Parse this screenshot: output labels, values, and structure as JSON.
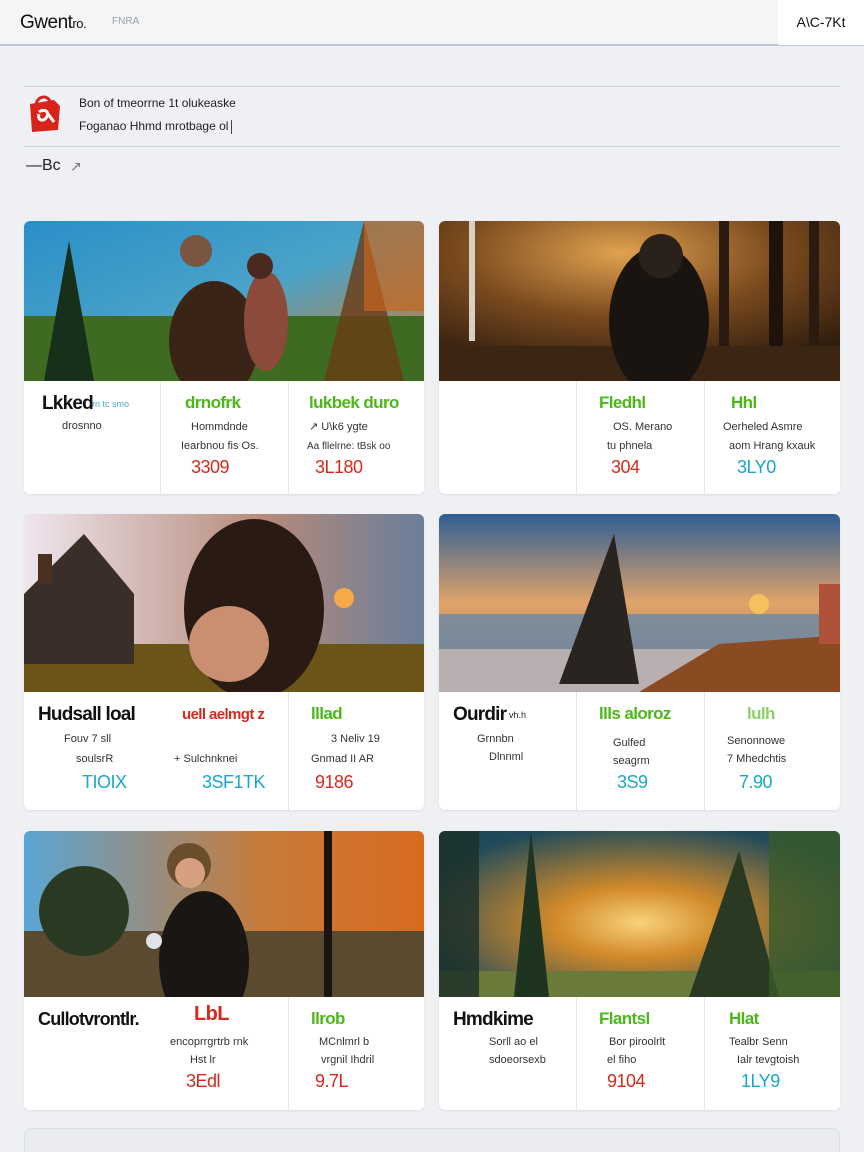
{
  "topbar": {
    "brand": "Gwent",
    "brand_suffix": "ro.",
    "brand_sub": "FNRA",
    "right_label": "A\\C-7Kt"
  },
  "notice": {
    "line1": "Bon of tmeorrne 1t olukeaske",
    "line2": "Foganao Hhmd mrotbage ol"
  },
  "sort": {
    "label": "—Bc",
    "arrow": "↗"
  },
  "cards": [
    {
      "title": "Lkked",
      "title_sub": "rn tc smo",
      "sub1": "drosnno",
      "c2": {
        "label": "drnofrk",
        "line1": "Hommdnde",
        "line2": "Iearbnou fis Os.",
        "price": "3309"
      },
      "c3": {
        "label": "lukbek duro",
        "line1": "↗ U\\k6 ygte",
        "line2": "Aa fllelrne: tBsk oo",
        "price": "3L180"
      }
    },
    {
      "title": "",
      "title_sub": "",
      "sub1": "",
      "c2": {
        "label": "Fledhl",
        "line1": "OS. Merano",
        "line2": "tu phnela",
        "price": "304"
      },
      "c3": {
        "label": "Hhl",
        "line1": "Oerheled Asmre",
        "line2": "aom Hrang kxauk",
        "price": "3LY0"
      }
    },
    {
      "title": "Hudsall loal",
      "title_sub": "",
      "sub1": "Fouv 7 sll",
      "sub2": "soulsrR",
      "sub_price": "TIOIX",
      "c2": {
        "label": "uell aelmgt z",
        "line1": "",
        "line2": "+ Sulchnknei",
        "price": "3SF1TK"
      },
      "c3": {
        "label": "lllad",
        "line1": "3 Neliv 19",
        "line2": "Gnmad II AR",
        "price": "9186"
      }
    },
    {
      "title": "Ourdir",
      "title_sub": "vh.h",
      "sub1": "Grnnbn",
      "sub2": "Dlnnml",
      "c2": {
        "label": "llls aloroz",
        "line1": "Gulfed",
        "line2": "seagrm",
        "price": "3S9"
      },
      "c3": {
        "label": "lulh",
        "line1": "Senonnowe",
        "line2": "7 Mhedchtis",
        "price": "7.90"
      }
    },
    {
      "title": "Cullotvrontlr.",
      "title_sub": "",
      "sub1": "",
      "c2": {
        "label": "LbL",
        "line1": "encoprrgrtrb rnk",
        "line2": "Hst lr",
        "price": "3Edl"
      },
      "c3": {
        "label": "llrob",
        "line1": "MCnlmrl b",
        "line2": "vrgnil Ihdril",
        "price": "9.7L"
      }
    },
    {
      "title": "Hmdkime",
      "title_sub": "",
      "sub1": "Sorll ao el",
      "sub2": "sdoeorsexb",
      "c2": {
        "label": "Flantsl",
        "line1": "Bor piroolrlt",
        "line2": "el fiho",
        "price": "9104"
      },
      "c3": {
        "label": "Hlat",
        "line1": "Tealbr Senn",
        "line2": "Ialr tevgtoish",
        "price": "1LY9"
      }
    }
  ],
  "colors": {
    "accent_red": "#d42a1e",
    "accent_green": "#4ab817",
    "accent_cyan": "#19a8c7",
    "logo_red": "#d8231b"
  }
}
